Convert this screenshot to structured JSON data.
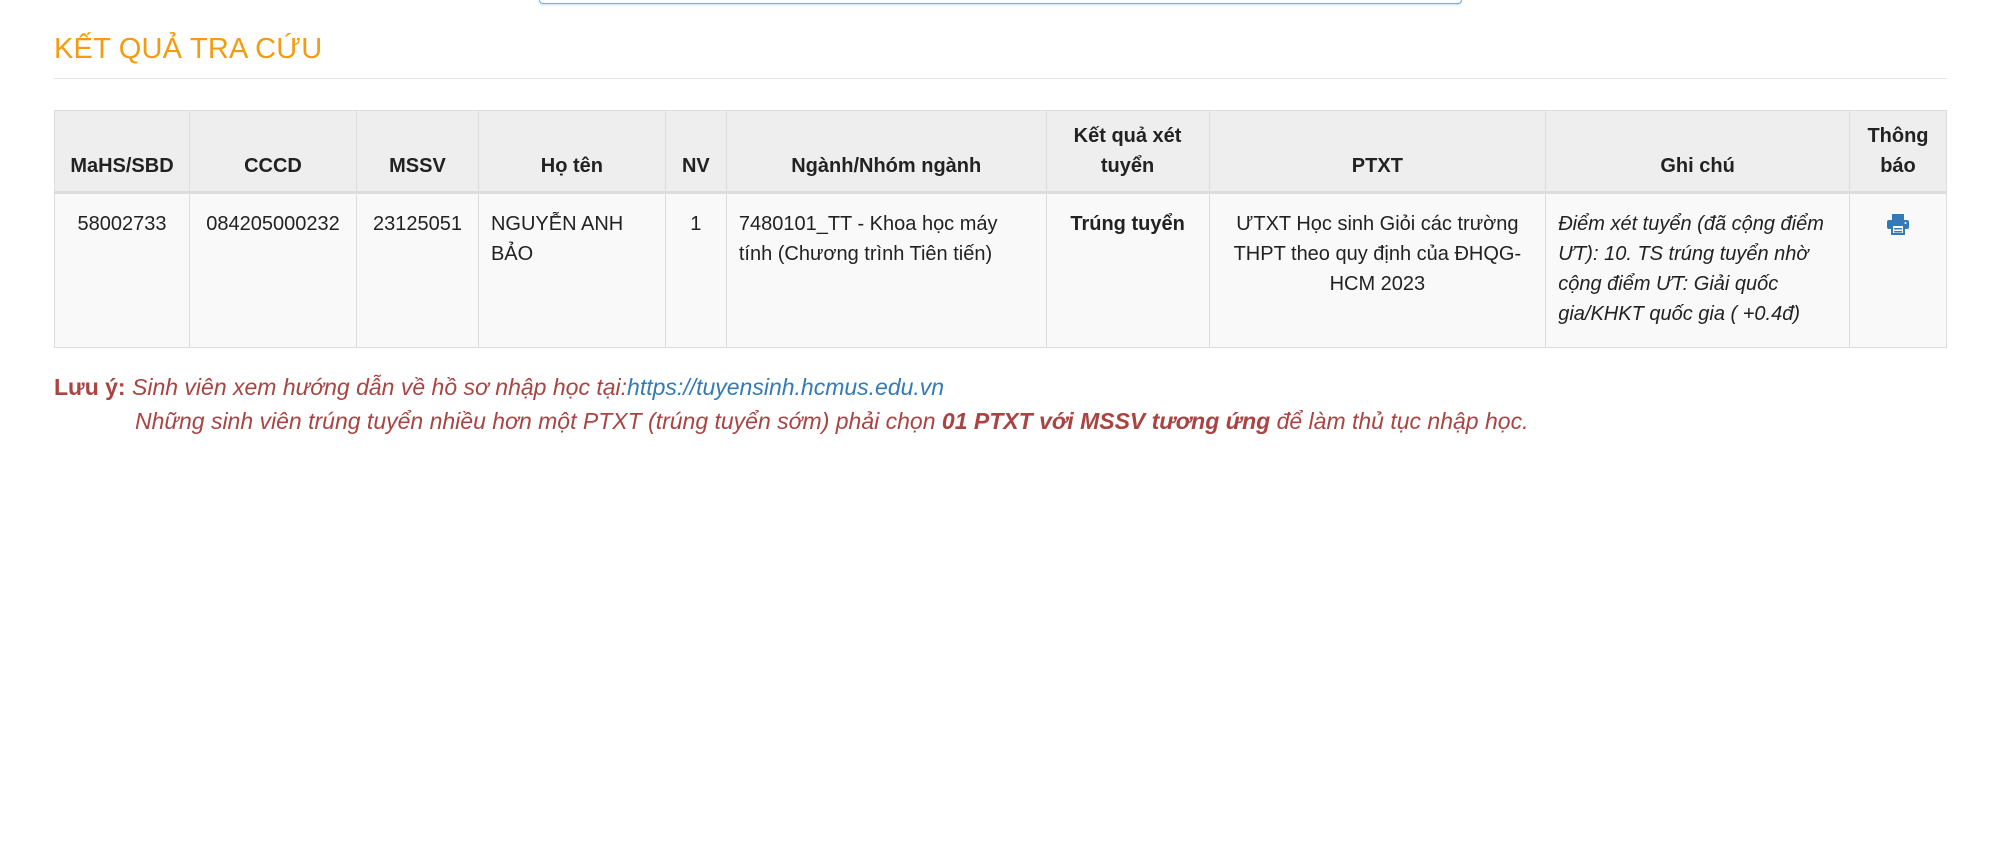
{
  "page": {
    "title": "KẾT QUẢ TRA CỨU"
  },
  "table": {
    "headers": {
      "mahs": "MaHS/SBD",
      "cccd": "CCCD",
      "mssv": "MSSV",
      "hoten": "Họ tên",
      "nv": "NV",
      "nganh": "Ngành/Nhóm ngành",
      "ketqua": "Kết quả xét tuyển",
      "ptxt": "PTXT",
      "ghichu": "Ghi chú",
      "thongbao": "Thông báo"
    },
    "rows": [
      {
        "mahs": "58002733",
        "cccd": "084205000232",
        "mssv": "23125051",
        "hoten": "NGUYỄN ANH BẢO",
        "nv": "1",
        "nganh": "7480101_TT - Khoa học máy tính (Chương trình Tiên tiến)",
        "ketqua": "Trúng tuyển",
        "ptxt": "ƯTXT Học sinh Giỏi các trường THPT theo quy định của ĐHQG-HCM 2023",
        "ghichu": "Điểm xét tuyển (đã cộng điểm ƯT): 10. TS trúng tuyển nhờ cộng điểm ƯT: Giải quốc gia/KHKT quốc gia ( +0.4đ)",
        "thongbao_icon": "print-icon"
      }
    ]
  },
  "notice": {
    "label": "Lưu ý:",
    "line1_text": "Sinh viên xem hướng dẫn về hồ sơ nhập học tại:",
    "link_text": "https://tuyensinh.hcmus.edu.vn",
    "line2_prefix": "Những sinh viên trúng tuyển nhiều hơn một PTXT (trúng tuyển sớm) phải chọn ",
    "line2_strong": "01 PTXT với MSSV tương ứng",
    "line2_suffix": " để làm thủ tục nhập học."
  },
  "colors": {
    "title": "#f39c12",
    "notice": "#a94442",
    "link": "#337ab7",
    "print_icon": "#337ab7"
  }
}
